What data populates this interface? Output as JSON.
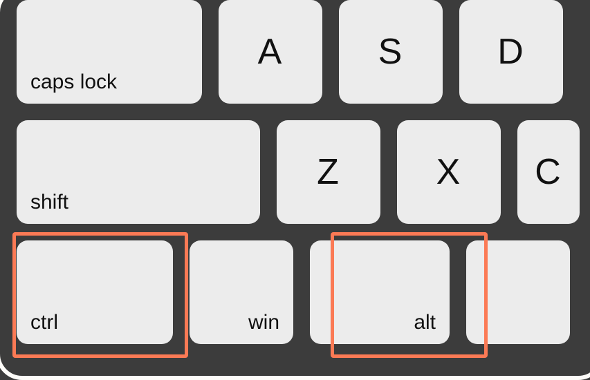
{
  "rows": {
    "r1": {
      "caps": "caps lock",
      "a": "A",
      "s": "S",
      "d": "D"
    },
    "r2": {
      "shift": "shift",
      "z": "Z",
      "x": "X",
      "c": "C"
    },
    "r3": {
      "ctrl": "ctrl",
      "win": "win",
      "alt": "alt"
    }
  },
  "highlight": {
    "color": "#fb7a55",
    "keys": [
      "ctrl",
      "alt"
    ]
  }
}
